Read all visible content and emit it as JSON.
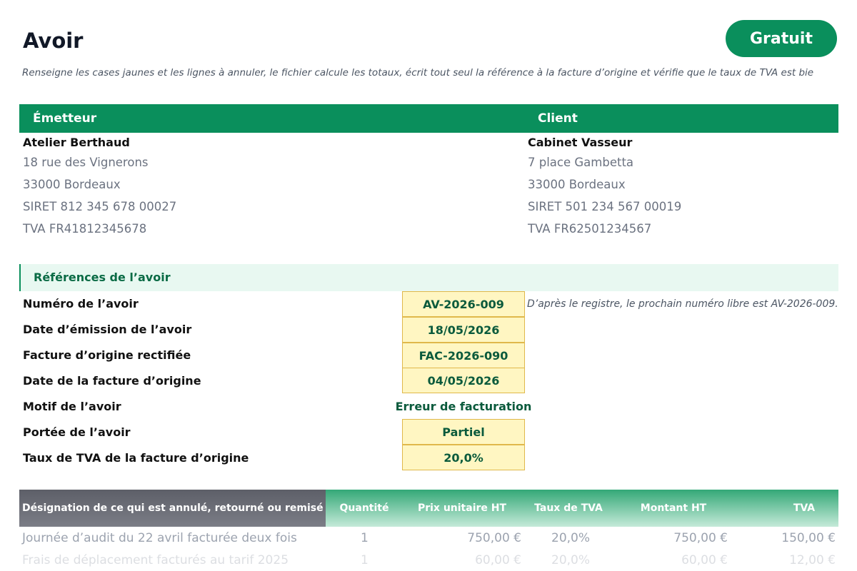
{
  "header": {
    "title": "Avoir",
    "badge": "Gratuit",
    "subtitle": "Renseigne les cases jaunes et les lignes à annuler, le fichier calcule les totaux, écrit tout seul la référence à la facture d’origine et vérifie que le taux de TVA est bie"
  },
  "parties": {
    "emitter_heading": "Émetteur",
    "client_heading": "Client",
    "emitter": {
      "name": "Atelier Berthaud",
      "address": "18 rue des Vignerons",
      "city": "33000 Bordeaux",
      "siret": "SIRET 812 345 678 00027",
      "tva": "TVA FR41812345678"
    },
    "client": {
      "name": "Cabinet Vasseur",
      "address": "7 place Gambetta",
      "city": "33000 Bordeaux",
      "siret": "SIRET 501 234 567 00019",
      "tva": "TVA FR62501234567"
    }
  },
  "references": {
    "heading": "Références de l’avoir",
    "note": "D’après le registre, le prochain numéro libre est AV-2026-009.",
    "fields": [
      {
        "label": "Numéro de l’avoir",
        "value": "AV-2026-009"
      },
      {
        "label": "Date d’émission de l’avoir",
        "value": "18/05/2026"
      },
      {
        "label": "Facture d’origine rectifiée",
        "value": "FAC-2026-090"
      },
      {
        "label": "Date de la facture d’origine",
        "value": "04/05/2026"
      },
      {
        "label": "Motif de l’avoir",
        "value": "Erreur de facturation"
      },
      {
        "label": "Portée de l’avoir",
        "value": "Partiel"
      },
      {
        "label": "Taux de TVA de la facture d’origine",
        "value": "20,0%"
      }
    ]
  },
  "table": {
    "headers": [
      "Désignation de ce qui est annulé, retourné ou remisé",
      "Quantité",
      "Prix unitaire HT",
      "Taux de TVA",
      "Montant HT",
      "TVA"
    ],
    "rows": [
      [
        "Journée d’audit du 22 avril facturée deux fois",
        "1",
        "750,00 €",
        "20,0%",
        "750,00 €",
        "150,00 €"
      ],
      [
        "Frais de déplacement facturés au tarif 2025",
        "1",
        "60,00 €",
        "20,0%",
        "60,00 €",
        "12,00 €"
      ]
    ]
  },
  "colors": {
    "accent": "#0a8f5c",
    "input_fill": "#fff6c2",
    "input_border": "#e0b84b"
  }
}
